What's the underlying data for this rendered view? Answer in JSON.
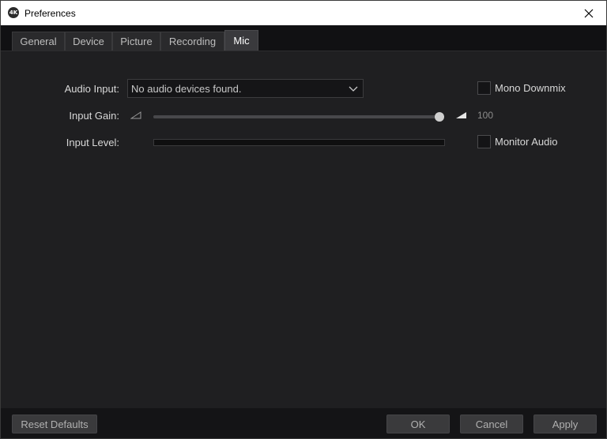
{
  "window": {
    "title": "Preferences",
    "app_icon_text": "4K"
  },
  "tabs": [
    {
      "label": "General",
      "active": false
    },
    {
      "label": "Device",
      "active": false
    },
    {
      "label": "Picture",
      "active": false
    },
    {
      "label": "Recording",
      "active": false
    },
    {
      "label": "Mic",
      "active": true
    }
  ],
  "mic": {
    "audio_input_label": "Audio Input:",
    "audio_input_value": "No audio devices found.",
    "input_gain_label": "Input Gain:",
    "input_gain_value": "100",
    "input_gain_fraction": 1.0,
    "input_level_label": "Input Level:",
    "input_level_fraction": 0,
    "mono_downmix_label": "Mono Downmix",
    "mono_downmix_checked": false,
    "monitor_audio_label": "Monitor Audio",
    "monitor_audio_checked": false
  },
  "footer": {
    "reset_label": "Reset Defaults",
    "ok_label": "OK",
    "cancel_label": "Cancel",
    "apply_label": "Apply"
  },
  "icons": {
    "close": "close-icon",
    "chevron": "chevron-down-icon",
    "volume_low": "volume-low-icon",
    "volume_high": "volume-high-icon"
  }
}
